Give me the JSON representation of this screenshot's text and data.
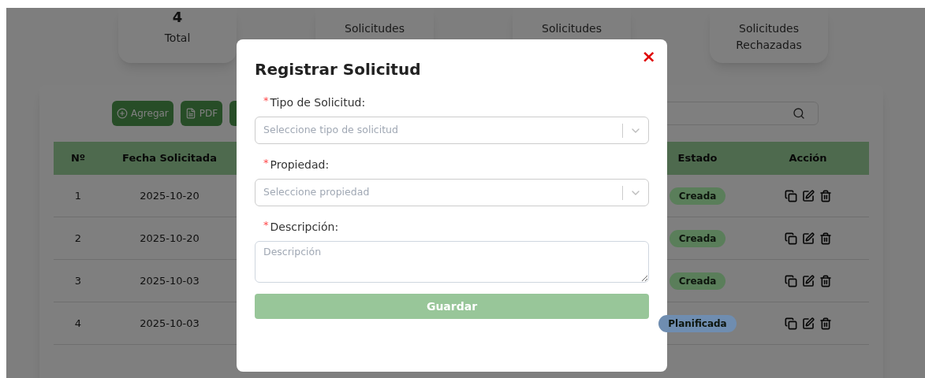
{
  "summary_cards": [
    {
      "count": "4",
      "label": "Total"
    },
    {
      "label": "Solicitudes"
    },
    {
      "label": "Solicitudes"
    },
    {
      "label": "Solicitudes Rechazadas"
    }
  ],
  "toolbar": {
    "buttons": [
      {
        "label": "Agregar",
        "kind": "add"
      },
      {
        "label": "PDF",
        "kind": "pdf"
      },
      {
        "kind": "other"
      }
    ]
  },
  "table": {
    "columns": [
      "Nº",
      "Fecha Solicitada",
      "Estado",
      "Acción"
    ],
    "rows": [
      {
        "number": "1",
        "date": "2025-10-20",
        "status": "Creada",
        "color": "#5a7e5a"
      },
      {
        "number": "2",
        "date": "2025-10-20",
        "status": "Creada",
        "color": "#5a7e5a"
      },
      {
        "number": "3",
        "date": "2025-10-03",
        "status": "Creada",
        "color": "#5a7e5a"
      },
      {
        "number": "4",
        "date": "2025-10-03",
        "status": "Planificada",
        "color": "#6f8db0"
      }
    ]
  },
  "modal": {
    "title": "Registrar Solicitud",
    "close": "×",
    "fields": [
      {
        "kind": "select",
        "required_mark": "*",
        "label": "Tipo de Solicitud:",
        "placeholder": "Seleccione tipo de solicitud"
      },
      {
        "kind": "select",
        "required_mark": "*",
        "label": "Propiedad:",
        "placeholder": "Seleccione propiedad"
      },
      {
        "kind": "textarea",
        "required_mark": "*",
        "label": "Descripción:",
        "placeholder": "Descripción"
      }
    ],
    "submit": "Guardar"
  }
}
